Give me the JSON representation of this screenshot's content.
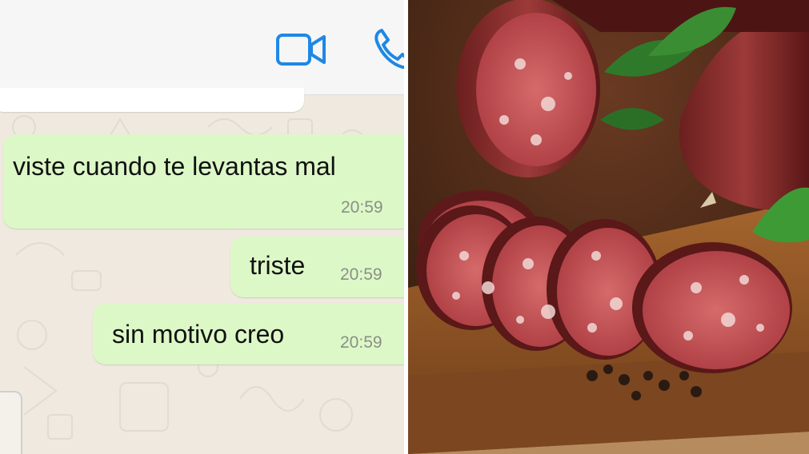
{
  "chat": {
    "messages": [
      {
        "text": "viste cuando te levantas mal",
        "time": "20:59"
      },
      {
        "text": "triste",
        "time": "20:59"
      },
      {
        "text": "sin motivo creo",
        "time": "20:59"
      }
    ],
    "header_icons": [
      "video-call-icon",
      "phone-call-icon"
    ],
    "colors": {
      "outgoing_bubble": "#dcf8c6",
      "accent": "#1e88e5",
      "wallpaper": "#efe9df"
    }
  },
  "photo": {
    "subject": "salami-slices-on-wooden-board",
    "icons": [
      "basil-leaf",
      "peppercorn"
    ]
  }
}
